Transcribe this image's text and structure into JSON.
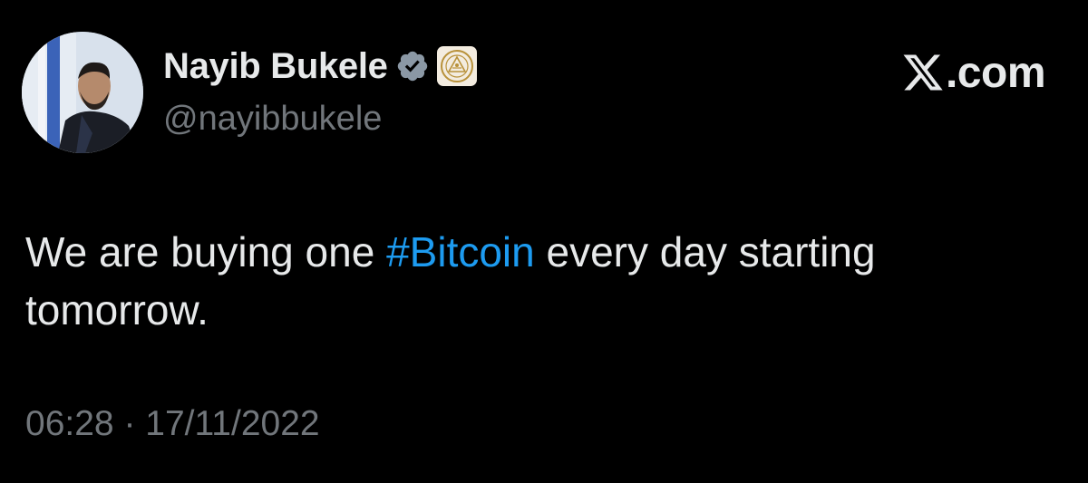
{
  "author": {
    "display_name": "Nayib Bukele",
    "handle": "@nayibbukele",
    "verified_icon": "verified-check-icon",
    "affiliation_icon": "el-salvador-coat-of-arms-icon",
    "verified_color": "#8b98a5"
  },
  "brand": {
    "logo_icon": "x-logo-icon",
    "text": ".com"
  },
  "tweet": {
    "text_before": "We are buying one ",
    "hashtag": "#Bitcoin",
    "text_after": " every day starting tomorrow.",
    "hashtag_color": "#1d9bf0"
  },
  "meta": {
    "time": "06:28",
    "separator": "·",
    "date": "17/11/2022"
  }
}
